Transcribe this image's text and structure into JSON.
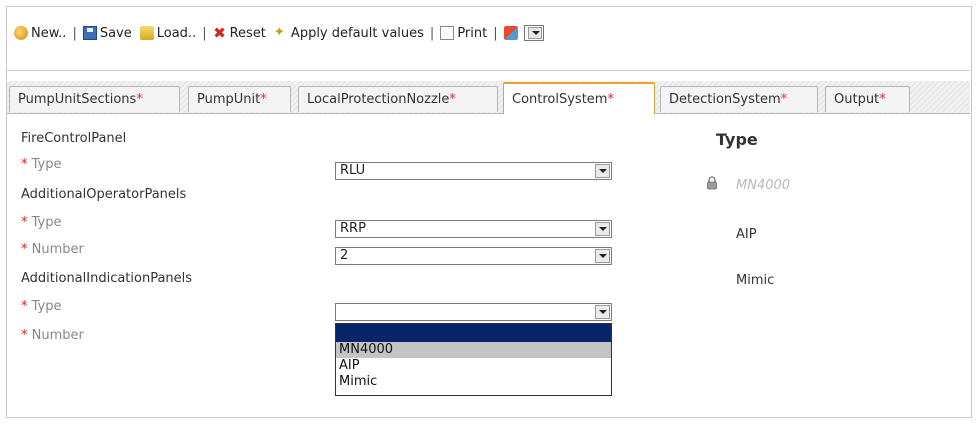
{
  "toolbar": {
    "new_label": "New..",
    "save_label": "Save",
    "load_label": "Load..",
    "reset_label": "Reset",
    "apply_label": "Apply default values",
    "print_label": "Print",
    "separator": "|"
  },
  "tabs": [
    {
      "label": "PumpUnitSections",
      "star": "*",
      "active": false
    },
    {
      "label": "PumpUnit",
      "star": "*",
      "active": false
    },
    {
      "label": "LocalProtectionNozzle",
      "star": "*",
      "active": false
    },
    {
      "label": "ControlSystem",
      "star": "*",
      "active": true
    },
    {
      "label": "DetectionSystem",
      "star": "*",
      "active": false
    },
    {
      "label": "Output",
      "star": "*",
      "active": false
    }
  ],
  "form": {
    "section1": "FireControlPanel",
    "section2": "AdditionalOperatorPanels",
    "section3": "AdditionalIndicationPanels",
    "req": "*",
    "type_label": "Type",
    "number_label": "Number",
    "fcp_type_value": "RLU",
    "aop_type_value": "RRP",
    "aop_number_value": "2",
    "aip_type_value": ""
  },
  "dropdown": {
    "options": [
      "",
      "MN4000",
      "AIP",
      "Mimic"
    ],
    "highlighted": "MN4000"
  },
  "type_panel": {
    "heading": "Type",
    "options": [
      {
        "label": "MN4000",
        "disabled": true,
        "locked": true
      },
      {
        "label": "AIP",
        "disabled": false
      },
      {
        "label": "Mimic",
        "disabled": false
      }
    ]
  },
  "colors": {
    "required_star": "#e02020",
    "active_tab_border": "#f0a030",
    "dropdown_selection": "#0a246a"
  }
}
